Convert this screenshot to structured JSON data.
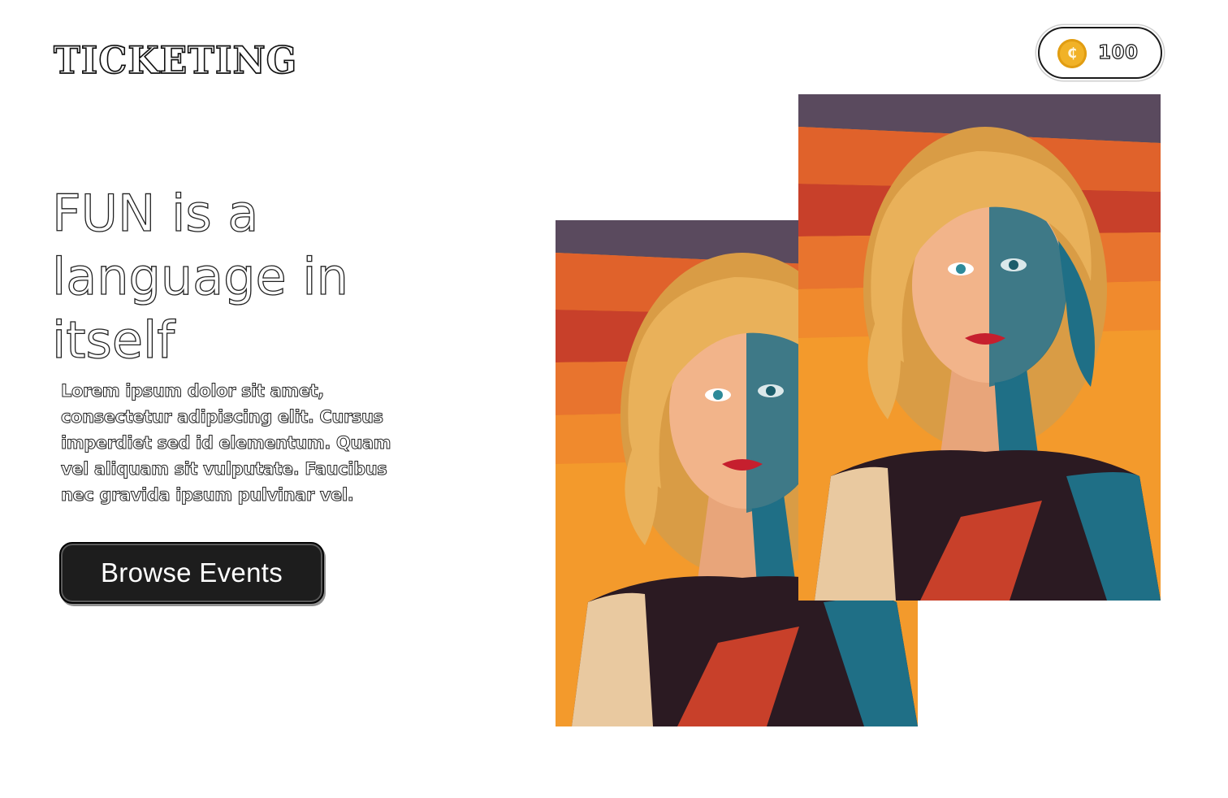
{
  "header": {
    "logo_text": "TICKETING",
    "balance": {
      "icon": "coin-icon",
      "coin_symbol": "₵",
      "value": "100",
      "coin_color": "#f1b227"
    }
  },
  "hero": {
    "headline": "FUN is a language in itself",
    "body": "Lorem ipsum dolor sit amet, consectetur adipiscing elit. Cursus imperdiet sed id elementum. Quam vel aliquam sit vulputate. Faucibus nec gravida ipsum pulvinar vel.",
    "cta_label": "Browse Events"
  },
  "artwork": {
    "description_icon": "portrait-illustration",
    "palette": {
      "sky_dark": "#5a4a5e",
      "ray_orange": "#e0622b",
      "ray_red": "#c8402a",
      "warm": "#f39a2c",
      "hair": "#e9b15a",
      "skin": "#f2b48a",
      "shadow": "#1f6f86",
      "shirt": "#2b1a22"
    }
  }
}
